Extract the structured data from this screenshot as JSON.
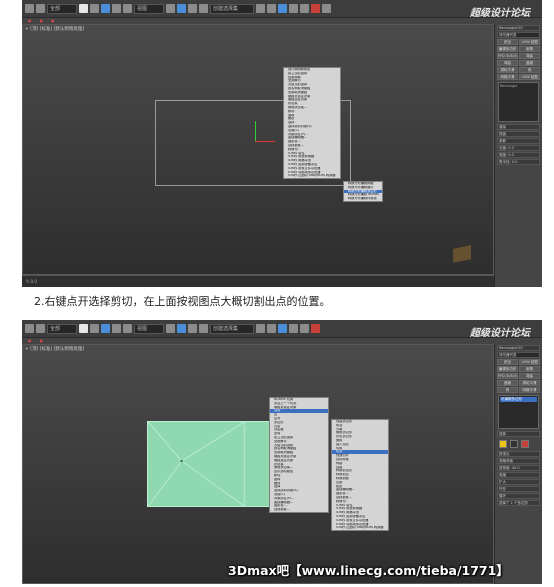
{
  "caption": "2.右键点开选择剪切，在上面按视图点大概切割出点的位置。",
  "banner": "3Dmax吧【www.linecg.com/tieba/1771】",
  "logo": "超级设计论坛",
  "colors": {
    "accent": "#3b6fc2",
    "viewport_shape": "#8fd8b0",
    "watermark": "#c88e2e"
  },
  "shot1": {
    "viewport_label": "+ [顶] [标准] [默认明暗处理]",
    "status": "Y: 0.0",
    "toolbar": {
      "select_label": "全部",
      "view_label": "视图",
      "set_label": "创建选择集"
    },
    "panel": {
      "object_name": "Rectangle001",
      "modifier_list": "修改器列表",
      "buttons": [
        "挤出",
        "UVW 贴图",
        "编辑多边形",
        "倒角",
        "FFD 3x3x3",
        "弯曲",
        "弯曲",
        "晶格",
        "涡轮平滑",
        "壳",
        "网格平滑",
        "UVW 贴图"
      ],
      "stack_item": "Rectangle",
      "sections": [
        "渲染",
        "插值",
        "参数"
      ],
      "params": [
        "长度: 0.0",
        "宽度: 0.0",
        "角半径: 0.0"
      ]
    },
    "context_menu": [
      "视口照明和阴影",
      "孤立当前选择",
      "结束隔离",
      "全部解冻",
      "冻结当前选择",
      "按名称取消隐藏",
      "全部取消隐藏",
      "隐藏未选定对象",
      "隐藏选定对象",
      "状态集",
      "管理状态集...",
      "移动",
      "旋转",
      "缩放",
      "选择",
      "选择类似对象(S)",
      "克隆(C)",
      "对象属性(P)...",
      "曲线编辑器...",
      "摄影表...",
      "连线参数...",
      "转换为:",
      "V-Ray 属性",
      "V-Ray 场景转换器",
      "V-Ray 网格导出",
      "V-Ray 虚拟帧缓冲区",
      "V-Ray 场景文件导出器",
      "V-Ray 动画场景导出器",
      "V-Ray 位图向 VRayHDRI 转换器"
    ],
    "convert_submenu": [
      "转换为可编辑网格",
      "转换为可编辑面片",
      "转换为可编辑多边形",
      "转换为可编辑 NURBS",
      "转换为可编辑样条线"
    ],
    "convert_highlight_index": 2
  },
  "shot2": {
    "viewport_label": "+ [顶] [标准] [默认明暗处理]",
    "panel": {
      "object_name": "Rectangle001",
      "modifier_list": "修改器列表",
      "buttons": [
        "挤出",
        "UVW 贴图",
        "编辑多边形",
        "倒角",
        "FFD 3x3x3",
        "弯曲",
        "晶格",
        "涡轮平滑",
        "壳",
        "网格平滑"
      ],
      "stack_item": "可编辑多边形",
      "section": "选择",
      "checks": [
        "按顶点",
        "忽略背面",
        "按角度: 45.0",
        "收缩",
        "扩大",
        "环形",
        "循环"
      ],
      "footer": "选择了 1 个多边形"
    },
    "left_menu": [
      "NURMS 切换",
      "重复上一个切割",
      "隐藏未选定对象",
      "顶点",
      "边",
      "边界",
      "多边形",
      "元素",
      "顶层级",
      "反转",
      "孤立当前选择",
      "全部解冻",
      "冻结当前选择",
      "按名称取消隐藏",
      "全部取消隐藏",
      "隐藏未选定对象",
      "隐藏选定对象",
      "状态集",
      "管理状态集...",
      "显示运动路径",
      "移动",
      "旋转",
      "缩放",
      "选择",
      "选择类似对象(S)",
      "克隆(C)",
      "对象属性(P)...",
      "曲线编辑器...",
      "摄影表...",
      "连线参数..."
    ],
    "left_menu_highlight_index": 3,
    "right_menu": [
      "创建多边形",
      "附加",
      "分离",
      "倒角多边形",
      "挤出多边形",
      "倒角",
      "插入顶点",
      "切角",
      "切割",
      "快速切片",
      "目标焊接",
      "焊接",
      "连接",
      "转换到顶点",
      "转换到边",
      "转换到面",
      "复制",
      "粘贴",
      "曲线编辑器...",
      "摄影表...",
      "连线参数...",
      "转换为:",
      "V-Ray 属性",
      "V-Ray 场景转换器",
      "V-Ray 网格导出",
      "V-Ray 虚拟帧缓冲区",
      "V-Ray 场景文件导出器",
      "V-Ray 动画场景导出器",
      "V-Ray 位图向 VRayHDRI 转换器"
    ],
    "right_menu_highlight_index": 8
  }
}
